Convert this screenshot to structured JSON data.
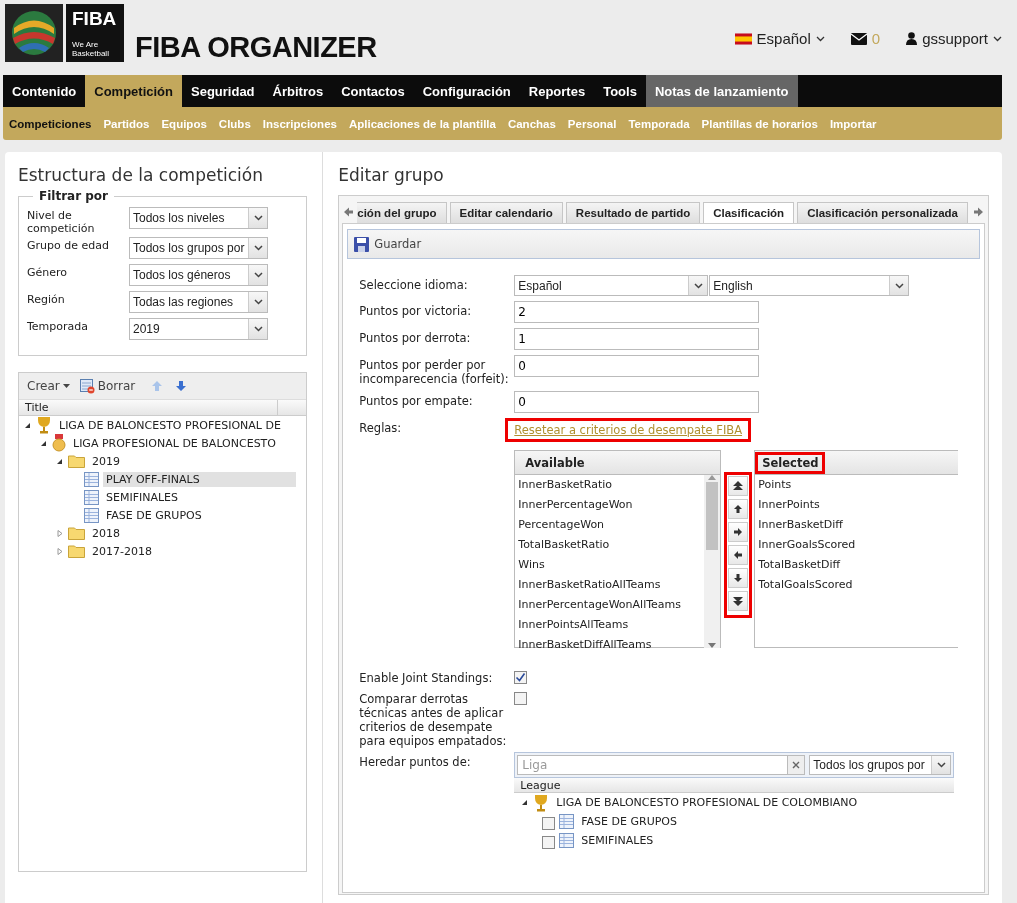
{
  "header": {
    "logo_text": "FIBA",
    "logo_tagline": "We Are Basketball",
    "title": "FIBA ORGANIZER",
    "language": "Español",
    "messages": "0",
    "user": "gssupport"
  },
  "nav": [
    {
      "label": "Contenido",
      "selected": false,
      "kind": "menu"
    },
    {
      "label": "Competición",
      "selected": true,
      "kind": "menu"
    },
    {
      "label": "Seguridad",
      "selected": false,
      "kind": "menu"
    },
    {
      "label": "Árbitros",
      "selected": false,
      "kind": "menu"
    },
    {
      "label": "Contactos",
      "selected": false,
      "kind": "menu"
    },
    {
      "label": "Configuración",
      "selected": false,
      "kind": "menu"
    },
    {
      "label": "Reportes",
      "selected": false,
      "kind": "menu"
    },
    {
      "label": "Tools",
      "selected": false,
      "kind": "menu"
    },
    {
      "label": "Notas de lanzamiento",
      "selected": false,
      "kind": "notes"
    }
  ],
  "subnav": [
    {
      "label": "Competiciones",
      "selected": true
    },
    {
      "label": "Partidos",
      "selected": false
    },
    {
      "label": "Equipos",
      "selected": false
    },
    {
      "label": "Clubs",
      "selected": false
    },
    {
      "label": "Inscripciones",
      "selected": false
    },
    {
      "label": "Aplicaciones de la plantilla",
      "selected": false
    },
    {
      "label": "Canchas",
      "selected": false
    },
    {
      "label": "Personal",
      "selected": false
    },
    {
      "label": "Temporada",
      "selected": false
    },
    {
      "label": "Plantillas de horarios",
      "selected": false
    },
    {
      "label": "Importar",
      "selected": false
    }
  ],
  "left": {
    "title": "Estructura de la competición",
    "filter_legend": "Filtrar por",
    "filters": [
      {
        "label": "Nivel de competición",
        "value": "Todos los niveles"
      },
      {
        "label": "Grupo de edad",
        "value": "Todos los grupos por"
      },
      {
        "label": "Género",
        "value": "Todos los géneros"
      },
      {
        "label": "Región",
        "value": "Todas las regiones"
      },
      {
        "label": "Temporada",
        "value": "2019"
      }
    ],
    "create": "Crear",
    "delete": "Borrar",
    "column": "Title",
    "tree": [
      {
        "label": "LIGA DE BALONCESTO PROFESIONAL DE",
        "kind": "trophy",
        "expanded": true,
        "selected": false,
        "children": [
          {
            "label": "LIGA PROFESIONAL DE BALONCESTO",
            "kind": "medal",
            "expanded": true,
            "selected": false,
            "children": [
              {
                "label": "2019",
                "kind": "folder",
                "expanded": true,
                "selected": false,
                "children": [
                  {
                    "label": "PLAY OFF-FINALS",
                    "kind": "table",
                    "selected": true
                  },
                  {
                    "label": "SEMIFINALES",
                    "kind": "table",
                    "selected": false
                  },
                  {
                    "label": "FASE DE GRUPOS",
                    "kind": "table",
                    "selected": false
                  }
                ]
              },
              {
                "label": "2018",
                "kind": "folder",
                "expanded": false,
                "selected": false
              },
              {
                "label": "2017-2018",
                "kind": "folder",
                "expanded": false,
                "selected": false
              }
            ]
          }
        ]
      }
    ]
  },
  "right": {
    "title": "Editar grupo",
    "tabs": [
      {
        "label": "ción del grupo",
        "selected": false
      },
      {
        "label": "Editar calendario",
        "selected": false
      },
      {
        "label": "Resultado de partido",
        "selected": false
      },
      {
        "label": "Clasificación",
        "selected": true
      },
      {
        "label": "Clasificación personalizada",
        "selected": false
      }
    ],
    "save": "Guardar",
    "language_label": "Seleccione idioma:",
    "languages": [
      "Español",
      "English"
    ],
    "fields": [
      {
        "label": "Puntos por victoria:",
        "value": "2"
      },
      {
        "label": "Puntos por derrota:",
        "value": "1"
      },
      {
        "label": "Puntos por perder por incomparecencia (forfeit):",
        "value": "0"
      },
      {
        "label": "Puntos por empate:",
        "value": "0"
      }
    ],
    "rules_label": "Reglas:",
    "rules_link": {
      "label": "Resetear a criterios de desempate FIBA",
      "highlighted": true
    },
    "available": {
      "header": "Available",
      "items": [
        "InnerBasketRatio",
        "InnerPercentageWon",
        "PercentageWon",
        "TotalBasketRatio",
        "Wins",
        "InnerBasketRatioAllTeams",
        "InnerPercentageWonAllTeams",
        "InnerPointsAllTeams",
        "InnerBasketDiffAllTeams"
      ]
    },
    "move_buttons": {
      "highlighted": true
    },
    "selected_list": {
      "header": "Selected",
      "highlighted": true,
      "items": [
        "Points",
        "InnerPoints",
        "InnerBasketDiff",
        "InnerGoalsScored",
        "TotalBasketDiff",
        "TotalGoalsScored"
      ]
    },
    "checkboxes": [
      {
        "label": "Enable Joint Standings:",
        "checked": true
      },
      {
        "label": "Comparar derrotas técnicas antes de aplicar criterios de desempate para equipos empatados:",
        "checked": false
      }
    ],
    "inherit": {
      "label": "Heredar puntos de:",
      "placeholder": "Liga",
      "group": "Todos los grupos por",
      "column": "League",
      "tree": [
        {
          "label": "LIGA DE BALONCESTO PROFESIONAL DE COLOMBIANO",
          "kind": "trophy",
          "expanded": true,
          "children": [
            {
              "label": "FASE DE GRUPOS",
              "kind": "table",
              "checked": false
            },
            {
              "label": "SEMIFINALES",
              "kind": "table",
              "checked": false
            }
          ]
        }
      ]
    }
  }
}
